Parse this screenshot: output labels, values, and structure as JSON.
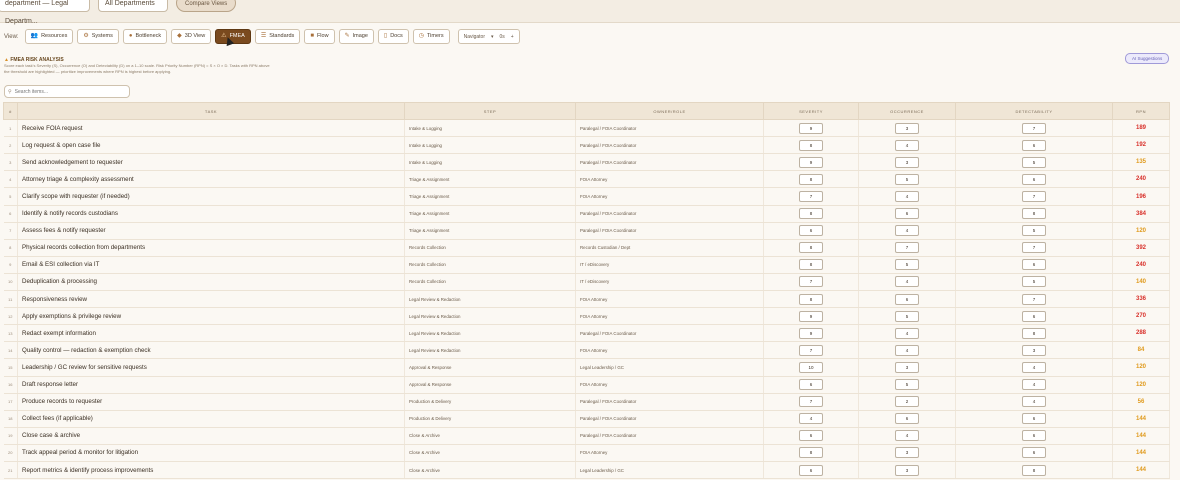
{
  "topbar": {
    "department_select": "department — Legal Departm...",
    "second_select": "All Departments",
    "top_button": "Compare Views"
  },
  "viewbar": {
    "label": "View:",
    "buttons": [
      {
        "label": "Resources",
        "icon": "people-icon",
        "glyph": "👥"
      },
      {
        "label": "Systems",
        "icon": "systems-icon",
        "glyph": "⚙"
      },
      {
        "label": "Bottleneck",
        "icon": "bottleneck-icon",
        "glyph": "●"
      },
      {
        "label": "3D View",
        "icon": "cube-icon",
        "glyph": "◆"
      },
      {
        "label": "FMEA",
        "icon": "warning-icon",
        "glyph": "⚠",
        "active": true
      },
      {
        "label": "Standards",
        "icon": "standards-icon",
        "glyph": "☰"
      },
      {
        "label": "Flow",
        "icon": "flow-icon",
        "glyph": "■"
      },
      {
        "label": "Image",
        "icon": "image-icon",
        "glyph": "✎"
      },
      {
        "label": "Docs",
        "icon": "docs-icon",
        "glyph": "▯"
      },
      {
        "label": "Timers",
        "icon": "timer-icon",
        "glyph": "◷"
      }
    ],
    "zoom_value": "Navigator",
    "zoom_minus": "0s",
    "zoom_plus": "+"
  },
  "fmea": {
    "title": "FMEA RISK ANALYSIS",
    "description": "Score each task's Severity (S), Occurrence (O) and Detectability (D) on a 1–10 scale. Risk Priority Number (RPN) = S × O × D. Tasks with RPN above the threshold are highlighted — prioritize improvements where RPN is highest before applying.",
    "badge": "AI Suggestions"
  },
  "search": {
    "placeholder": "Search items..."
  },
  "table": {
    "headers": [
      "#",
      "TASK",
      "STEP",
      "OWNER/ROLE",
      "SEVERITY",
      "OCCURRENCE",
      "DETECTABILITY",
      "RPN"
    ],
    "rows": [
      {
        "n": "1",
        "task": "Receive FOIA request",
        "step": "Intake & Logging",
        "owner": "Paralegal / FOIA Coordinator",
        "s": "9",
        "o": "3",
        "d": "7",
        "rpn": "189",
        "color": "#d8302a"
      },
      {
        "n": "2",
        "task": "Log request & open case file",
        "step": "Intake & Logging",
        "owner": "Paralegal / FOIA Coordinator",
        "s": "8",
        "o": "4",
        "d": "6",
        "rpn": "192",
        "color": "#d8302a"
      },
      {
        "n": "3",
        "task": "Send acknowledgement to requester",
        "step": "Intake & Logging",
        "owner": "Paralegal / FOIA Coordinator",
        "s": "9",
        "o": "3",
        "d": "5",
        "rpn": "135",
        "color": "#e09a1c"
      },
      {
        "n": "4",
        "task": "Attorney triage & complexity assessment",
        "step": "Triage & Assignment",
        "owner": "FOIA Attorney",
        "s": "8",
        "o": "5",
        "d": "6",
        "rpn": "240",
        "color": "#d8302a"
      },
      {
        "n": "5",
        "task": "Clarify scope with requester (if needed)",
        "step": "Triage & Assignment",
        "owner": "FOIA Attorney",
        "s": "7",
        "o": "4",
        "d": "7",
        "rpn": "196",
        "color": "#d8302a"
      },
      {
        "n": "6",
        "task": "Identify & notify records custodians",
        "step": "Triage & Assignment",
        "owner": "Paralegal / FOIA Coordinator",
        "s": "8",
        "o": "6",
        "d": "8",
        "rpn": "384",
        "color": "#d8302a"
      },
      {
        "n": "7",
        "task": "Assess fees & notify requester",
        "step": "Triage & Assignment",
        "owner": "Paralegal / FOIA Coordinator",
        "s": "6",
        "o": "4",
        "d": "5",
        "rpn": "120",
        "color": "#e09a1c"
      },
      {
        "n": "8",
        "task": "Physical records collection from departments",
        "step": "Records Collection",
        "owner": "Records Custodian / Dept",
        "s": "8",
        "o": "7",
        "d": "7",
        "rpn": "392",
        "color": "#d8302a"
      },
      {
        "n": "9",
        "task": "Email & ESI collection via IT",
        "step": "Records Collection",
        "owner": "IT / eDiscovery",
        "s": "8",
        "o": "5",
        "d": "6",
        "rpn": "240",
        "color": "#d8302a"
      },
      {
        "n": "10",
        "task": "Deduplication & processing",
        "step": "Records Collection",
        "owner": "IT / eDiscovery",
        "s": "7",
        "o": "4",
        "d": "5",
        "rpn": "140",
        "color": "#e09a1c"
      },
      {
        "n": "11",
        "task": "Responsiveness review",
        "step": "Legal Review & Redaction",
        "owner": "FOIA Attorney",
        "s": "8",
        "o": "6",
        "d": "7",
        "rpn": "336",
        "color": "#d8302a"
      },
      {
        "n": "12",
        "task": "Apply exemptions & privilege review",
        "step": "Legal Review & Redaction",
        "owner": "FOIA Attorney",
        "s": "9",
        "o": "5",
        "d": "6",
        "rpn": "270",
        "color": "#d8302a"
      },
      {
        "n": "13",
        "task": "Redact exempt information",
        "step": "Legal Review & Redaction",
        "owner": "Paralegal / FOIA Coordinator",
        "s": "9",
        "o": "4",
        "d": "8",
        "rpn": "288",
        "color": "#d8302a"
      },
      {
        "n": "14",
        "task": "Quality control — redaction & exemption check",
        "step": "Legal Review & Redaction",
        "owner": "FOIA Attorney",
        "s": "7",
        "o": "4",
        "d": "3",
        "rpn": "84",
        "color": "#e09a1c"
      },
      {
        "n": "15",
        "task": "Leadership / GC review for sensitive requests",
        "step": "Approval & Response",
        "owner": "Legal Leadership / GC",
        "s": "10",
        "o": "3",
        "d": "4",
        "rpn": "120",
        "color": "#e09a1c"
      },
      {
        "n": "16",
        "task": "Draft response letter",
        "step": "Approval & Response",
        "owner": "FOIA Attorney",
        "s": "6",
        "o": "5",
        "d": "4",
        "rpn": "120",
        "color": "#e09a1c"
      },
      {
        "n": "17",
        "task": "Produce records to requester",
        "step": "Production & Delivery",
        "owner": "Paralegal / FOIA Coordinator",
        "s": "7",
        "o": "2",
        "d": "4",
        "rpn": "56",
        "color": "#e09a1c"
      },
      {
        "n": "18",
        "task": "Collect fees (if applicable)",
        "step": "Production & Delivery",
        "owner": "Paralegal / FOIA Coordinator",
        "s": "4",
        "o": "6",
        "d": "6",
        "rpn": "144",
        "color": "#e09a1c"
      },
      {
        "n": "19",
        "task": "Close case & archive",
        "step": "Close & Archive",
        "owner": "Paralegal / FOIA Coordinator",
        "s": "6",
        "o": "4",
        "d": "6",
        "rpn": "144",
        "color": "#e09a1c"
      },
      {
        "n": "20",
        "task": "Track appeal period & monitor for litigation",
        "step": "Close & Archive",
        "owner": "FOIA Attorney",
        "s": "8",
        "o": "3",
        "d": "6",
        "rpn": "144",
        "color": "#e09a1c"
      },
      {
        "n": "21",
        "task": "Report metrics & identify process improvements",
        "step": "Close & Archive",
        "owner": "Legal Leadership / GC",
        "s": "6",
        "o": "3",
        "d": "8",
        "rpn": "144",
        "color": "#e09a1c"
      }
    ]
  }
}
